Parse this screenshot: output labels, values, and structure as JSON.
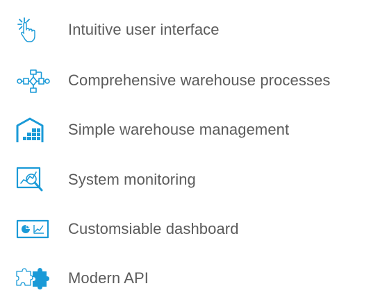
{
  "features": [
    {
      "label": "Intuitive user interface",
      "icon": "pointer-hand-icon"
    },
    {
      "label": "Comprehensive warehouse processes",
      "icon": "process-flowchart-icon"
    },
    {
      "label": "Simple warehouse management",
      "icon": "warehouse-icon"
    },
    {
      "label": "System monitoring",
      "icon": "monitoring-magnifier-icon"
    },
    {
      "label": "Customsiable dashboard",
      "icon": "dashboard-icon"
    },
    {
      "label": "Modern API",
      "icon": "puzzle-piece-icon"
    }
  ],
  "colors": {
    "accent": "#1a9ad7",
    "text": "#5b5b5b"
  }
}
